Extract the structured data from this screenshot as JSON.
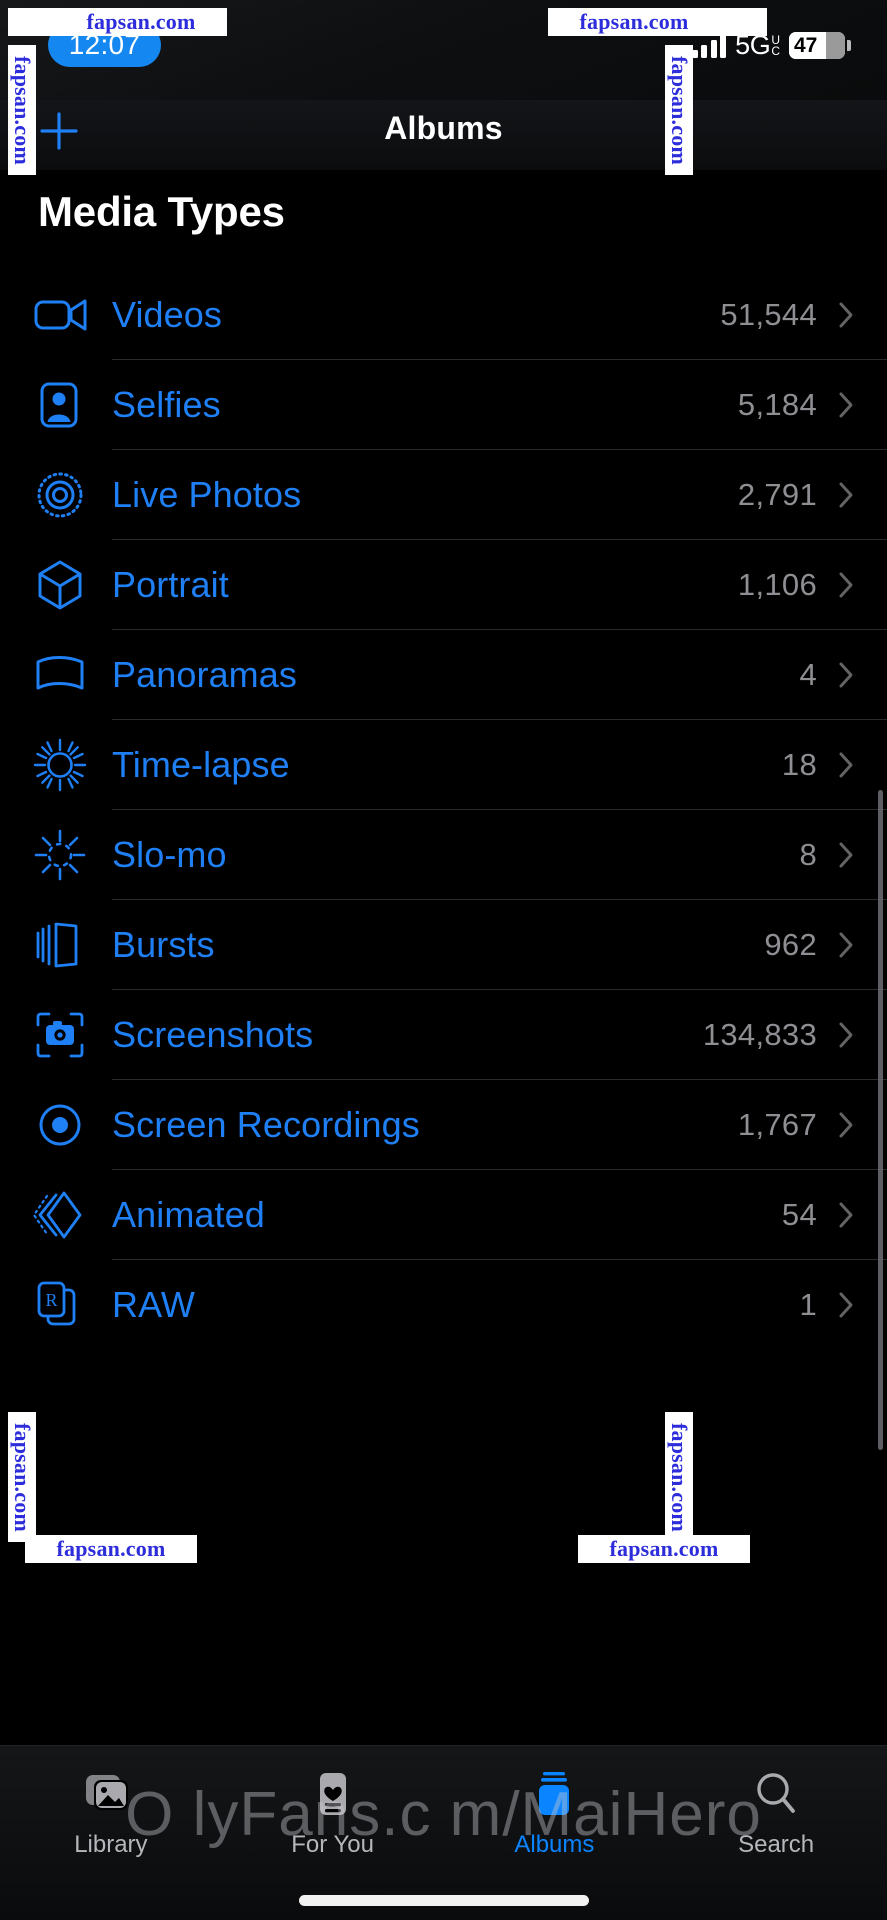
{
  "status_bar": {
    "time": "12:07",
    "network_label": "5G",
    "network_sub_upper": "U",
    "network_sub_lower": "C",
    "battery_percent": "47",
    "signal_icon": "cellular-signal-icon",
    "battery_icon": "battery-icon"
  },
  "nav_bar": {
    "add_icon": "plus-icon",
    "title": "Albums"
  },
  "section": {
    "title": "Media Types"
  },
  "media_types": [
    {
      "label": "Videos",
      "count": "51,544",
      "icon": "video-camera-icon"
    },
    {
      "label": "Selfies",
      "count": "5,184",
      "icon": "person-portrait-icon"
    },
    {
      "label": "Live Photos",
      "count": "2,791",
      "icon": "live-photo-icon"
    },
    {
      "label": "Portrait",
      "count": "1,106",
      "icon": "cube-icon"
    },
    {
      "label": "Panoramas",
      "count": "4",
      "icon": "panorama-icon"
    },
    {
      "label": "Time-lapse",
      "count": "18",
      "icon": "timelapse-icon"
    },
    {
      "label": "Slo-mo",
      "count": "8",
      "icon": "slomo-icon"
    },
    {
      "label": "Bursts",
      "count": "962",
      "icon": "burst-stack-icon"
    },
    {
      "label": "Screenshots",
      "count": "134,833",
      "icon": "screenshot-camera-icon"
    },
    {
      "label": "Screen Recordings",
      "count": "1,767",
      "icon": "record-circle-icon"
    },
    {
      "label": "Animated",
      "count": "54",
      "icon": "animated-chevrons-icon"
    },
    {
      "label": "RAW",
      "count": "1",
      "icon": "raw-document-icon"
    }
  ],
  "tab_bar": [
    {
      "label": "Library",
      "icon": "photo-stack-icon",
      "active": false
    },
    {
      "label": "For You",
      "icon": "heart-card-icon",
      "active": false
    },
    {
      "label": "Albums",
      "icon": "albums-box-icon",
      "active": true
    },
    {
      "label": "Search",
      "icon": "magnifier-icon",
      "active": false
    }
  ],
  "watermarks": {
    "site": "fapsan.com",
    "overlay": "O lyFans.c m/MaiHero"
  },
  "colors": {
    "accent_blue": "#1f7ff5",
    "tab_active_blue": "#0a84ff",
    "count_gray": "#8e8e93",
    "background": "#000000",
    "separator": "#2a2a2c"
  }
}
